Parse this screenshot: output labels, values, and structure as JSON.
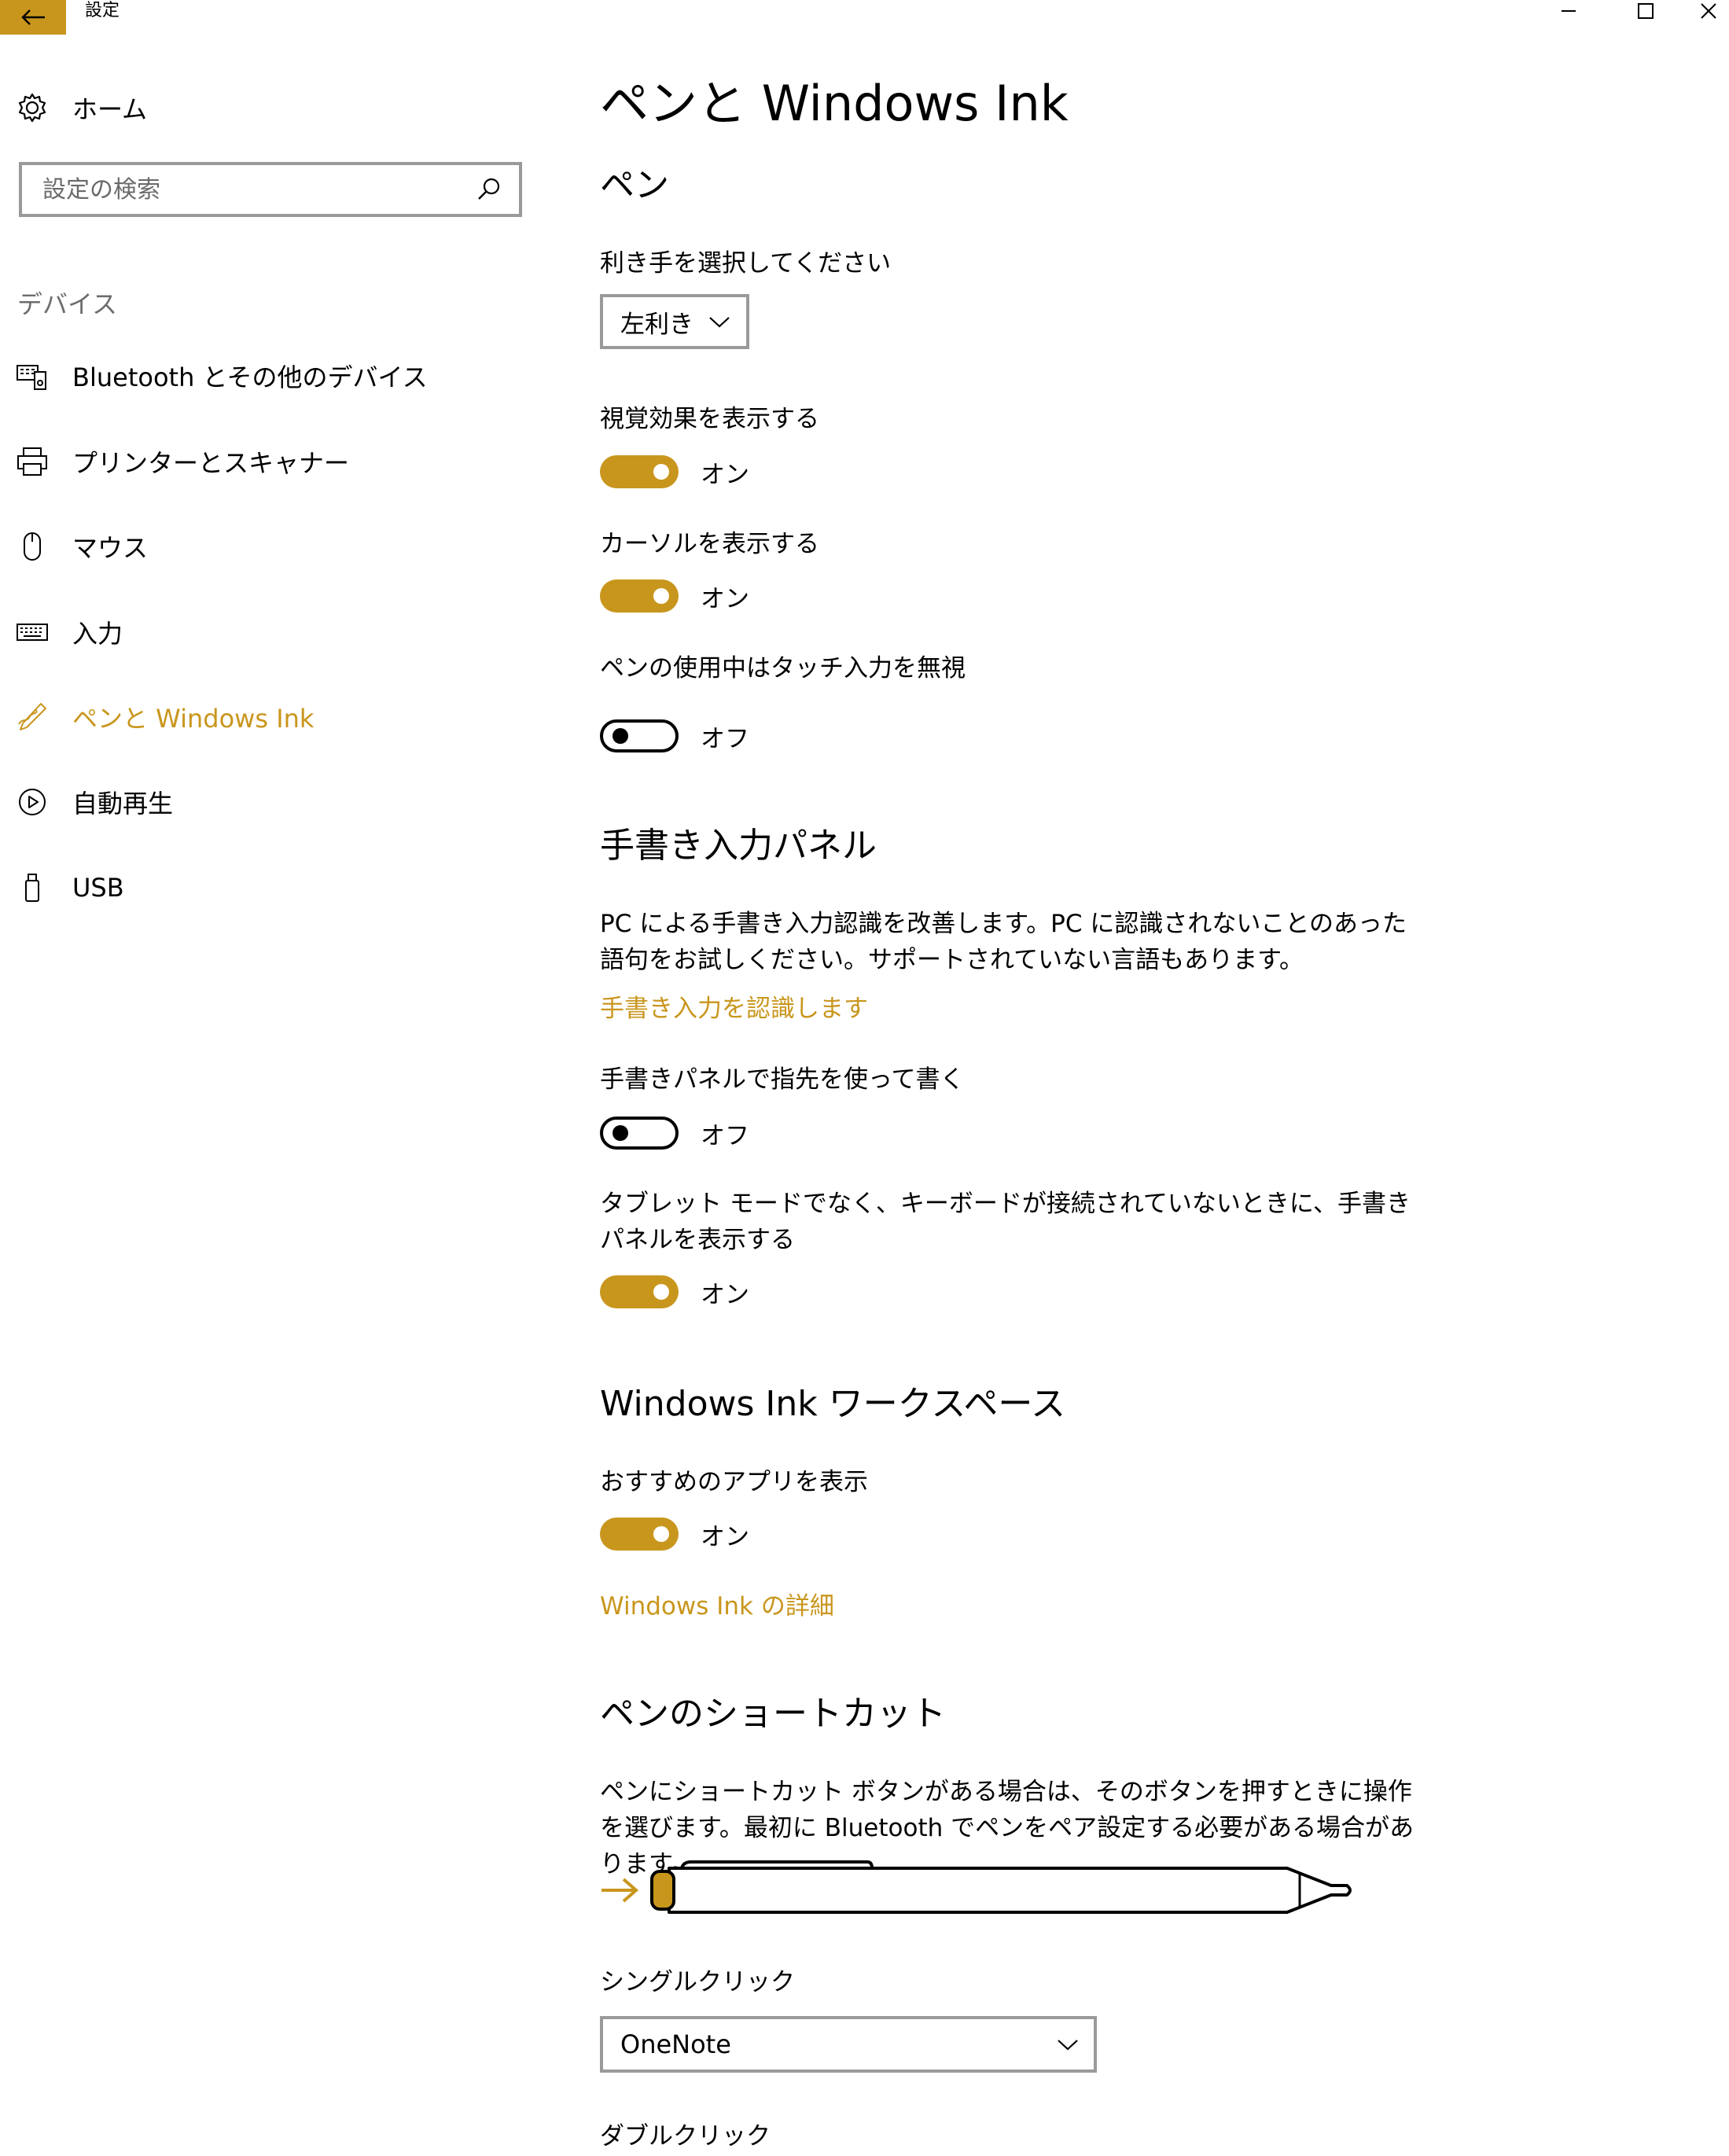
{
  "colors": {
    "accent": "#c9961d",
    "text": "#000000",
    "muted": "#6d6d6d",
    "border": "#9a9a9a"
  },
  "titlebar": {
    "title": "設定"
  },
  "sidebar": {
    "home_label": "ホーム",
    "search_placeholder": "設定の検索",
    "category": "デバイス",
    "items": [
      {
        "label": "Bluetooth とその他のデバイス",
        "icon": "bluetooth-devices-icon"
      },
      {
        "label": "プリンターとスキャナー",
        "icon": "printer-icon"
      },
      {
        "label": "マウス",
        "icon": "mouse-icon"
      },
      {
        "label": "入力",
        "icon": "keyboard-icon"
      },
      {
        "label": "ペンと Windows Ink",
        "icon": "pen-icon",
        "active": true
      },
      {
        "label": "自動再生",
        "icon": "autoplay-icon"
      },
      {
        "label": "USB",
        "icon": "usb-icon"
      }
    ]
  },
  "main": {
    "title": "ペンと Windows Ink",
    "pen": {
      "heading": "ペン",
      "handedness_label": "利き手を選択してください",
      "handedness_value": "左利き",
      "visual_effects_label": "視覚効果を表示する",
      "visual_effects_state": "オン",
      "cursor_label": "カーソルを表示する",
      "cursor_state": "オン",
      "ignore_touch_label": "ペンの使用中はタッチ入力を無視",
      "ignore_touch_state": "オフ"
    },
    "handwriting": {
      "heading": "手書き入力パネル",
      "description": "PC による手書き入力認識を改善します。PC に認識されないことのあった語句をお試しください。サポートされていない言語もあります。",
      "link": "手書き入力を認識します",
      "finger_label": "手書きパネルで指先を使って書く",
      "finger_state": "オフ",
      "show_panel_label": "タブレット モードでなく、キーボードが接続されていないときに、手書きパネルを表示する",
      "show_panel_state": "オン"
    },
    "workspace": {
      "heading": "Windows Ink ワークスペース",
      "suggested_label": "おすすめのアプリを表示",
      "suggested_state": "オン",
      "link": "Windows Ink の詳細"
    },
    "shortcut": {
      "heading": "ペンのショートカット",
      "description": "ペンにショートカット ボタンがある場合は、そのボタンを押すときに操作を選びます。最初に Bluetooth でペンをペア設定する必要がある場合があります。",
      "single_click_label": "シングルクリック",
      "single_click_value": "OneNote",
      "double_click_label": "ダブルクリック"
    }
  }
}
